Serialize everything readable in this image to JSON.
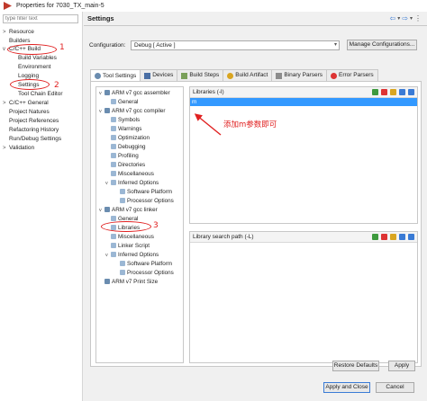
{
  "window": {
    "title": "Properties for 7030_TX_main-5"
  },
  "filter": {
    "placeholder": "type filter text"
  },
  "nav": {
    "items": [
      {
        "label": "Resource",
        "arrow": ">"
      },
      {
        "label": "Builders",
        "arrow": ""
      },
      {
        "label": "C/C++ Build",
        "arrow": "v"
      },
      {
        "label": "Build Variables",
        "arrow": ""
      },
      {
        "label": "Environment",
        "arrow": ""
      },
      {
        "label": "Logging",
        "arrow": ""
      },
      {
        "label": "Settings",
        "arrow": ""
      },
      {
        "label": "Tool Chain Editor",
        "arrow": ""
      },
      {
        "label": "C/C++ General",
        "arrow": ">"
      },
      {
        "label": "Project Natures",
        "arrow": ""
      },
      {
        "label": "Project References",
        "arrow": ""
      },
      {
        "label": "Refactoring History",
        "arrow": ""
      },
      {
        "label": "Run/Debug Settings",
        "arrow": ""
      },
      {
        "label": "Validation",
        "arrow": ">"
      }
    ]
  },
  "header": {
    "title": "Settings",
    "back": "⇦",
    "forward": "⇨",
    "dropdown": "▾",
    "menu": "⋮"
  },
  "config": {
    "label": "Configuration:",
    "value": "Debug  [ Active ]",
    "manage_label": "Manage Configurations..."
  },
  "tabs": [
    {
      "label": "Tool Settings",
      "icon": "tool-settings-icon"
    },
    {
      "label": "Devices",
      "icon": "devices-icon"
    },
    {
      "label": "Build Steps",
      "icon": "build-steps-icon"
    },
    {
      "label": "Build Artifact",
      "icon": "build-artifact-icon"
    },
    {
      "label": "Binary Parsers",
      "icon": "binary-parsers-icon"
    },
    {
      "label": "Error Parsers",
      "icon": "error-parsers-icon"
    }
  ],
  "tool_tree": [
    {
      "label": "ARM v7 gcc assembler",
      "arrow": "v"
    },
    {
      "label": "General",
      "arrow": ""
    },
    {
      "label": "ARM v7 gcc compiler",
      "arrow": "v"
    },
    {
      "label": "Symbols",
      "arrow": ""
    },
    {
      "label": "Warnings",
      "arrow": ""
    },
    {
      "label": "Optimization",
      "arrow": ""
    },
    {
      "label": "Debugging",
      "arrow": ""
    },
    {
      "label": "Profiling",
      "arrow": ""
    },
    {
      "label": "Directories",
      "arrow": ""
    },
    {
      "label": "Miscellaneous",
      "arrow": ""
    },
    {
      "label": "Inferred Options",
      "arrow": "v"
    },
    {
      "label": "Software Platform",
      "arrow": ""
    },
    {
      "label": "Processor Options",
      "arrow": ""
    },
    {
      "label": "ARM v7 gcc linker",
      "arrow": "v"
    },
    {
      "label": "General",
      "arrow": ""
    },
    {
      "label": "Libraries",
      "arrow": ""
    },
    {
      "label": "Miscellaneous",
      "arrow": ""
    },
    {
      "label": "Linker Script",
      "arrow": ""
    },
    {
      "label": "Inferred Options",
      "arrow": "v"
    },
    {
      "label": "Software Platform",
      "arrow": ""
    },
    {
      "label": "Processor Options",
      "arrow": ""
    },
    {
      "label": "ARM v7 Print Size",
      "arrow": ""
    }
  ],
  "libraries": {
    "title": "Libraries (-l)",
    "items": [
      "m"
    ]
  },
  "lib_search": {
    "title": "Library search path (-L)"
  },
  "annotation": {
    "text": "添加m参数即可",
    "color": "#e02020"
  },
  "markers": [
    "1",
    "2",
    "3"
  ],
  "buttons": {
    "restore": "Restore Defaults",
    "apply": "Apply",
    "apply_close": "Apply and Close",
    "cancel": "Cancel"
  },
  "colors": {
    "selection": "#3399ff",
    "annotation": "#e02020"
  }
}
